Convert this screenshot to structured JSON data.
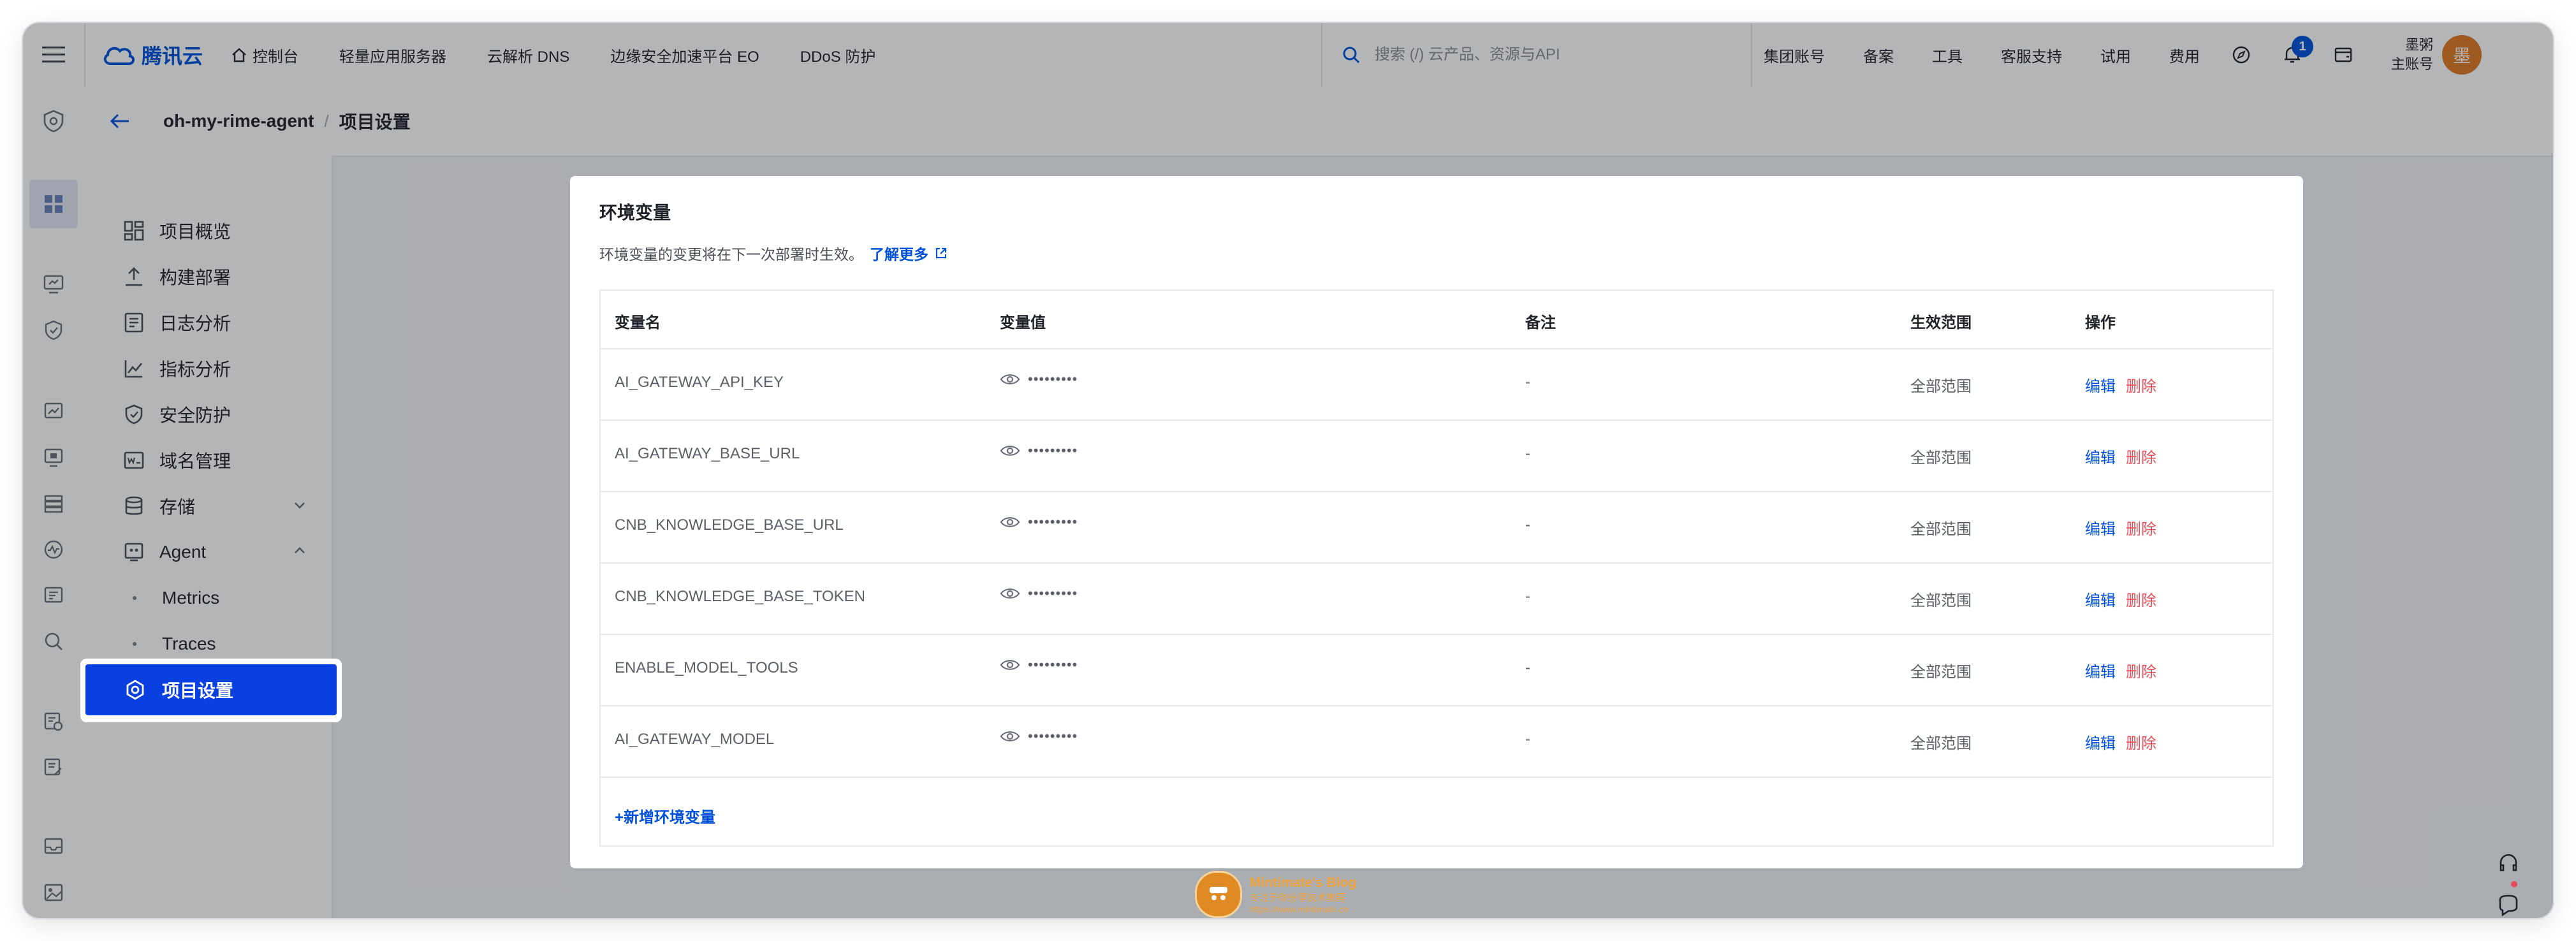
{
  "brand": {
    "name": "腾讯云"
  },
  "topnav": {
    "items": [
      "控制台",
      "轻量应用服务器",
      "云解析 DNS",
      "边缘安全加速平台 EO",
      "DDoS 防护"
    ],
    "search_placeholder": "搜索 (/) 云产品、资源与API",
    "right_items": [
      "集团账号",
      "备案",
      "工具",
      "客服支持",
      "试用",
      "费用"
    ],
    "notification_count": "1",
    "account_name": "墨粥",
    "account_role": "主账号",
    "avatar_char": "墨"
  },
  "breadcrumb": {
    "project": "oh-my-rime-agent",
    "separator": "/",
    "current": "项目设置"
  },
  "sidemenu": {
    "items": [
      {
        "label": "项目概览",
        "icon": "overview-icon"
      },
      {
        "label": "构建部署",
        "icon": "deploy-icon"
      },
      {
        "label": "日志分析",
        "icon": "log-icon"
      },
      {
        "label": "指标分析",
        "icon": "metrics-icon"
      },
      {
        "label": "安全防护",
        "icon": "shield-icon"
      },
      {
        "label": "域名管理",
        "icon": "domain-icon"
      },
      {
        "label": "存储",
        "icon": "storage-icon",
        "expanded": false
      },
      {
        "label": "Agent",
        "icon": "agent-icon",
        "expanded": true
      }
    ],
    "sub_items": [
      "Metrics",
      "Traces"
    ],
    "active": {
      "label": "项目设置",
      "icon": "settings-icon"
    }
  },
  "modal": {
    "title": "环境变量",
    "description": "环境变量的变更将在下一次部署时生效。",
    "learn_more": "了解更多",
    "columns": [
      "变量名",
      "变量值",
      "备注",
      "生效范围",
      "操作"
    ],
    "rows": [
      {
        "name": "AI_GATEWAY_API_KEY",
        "value": "•••••••••",
        "note": "-",
        "scope": "全部范围",
        "edit": "编辑",
        "delete": "删除"
      },
      {
        "name": "AI_GATEWAY_BASE_URL",
        "value": "•••••••••",
        "note": "-",
        "scope": "全部范围",
        "edit": "编辑",
        "delete": "删除"
      },
      {
        "name": "CNB_KNOWLEDGE_BASE_URL",
        "value": "•••••••••",
        "note": "-",
        "scope": "全部范围",
        "edit": "编辑",
        "delete": "删除"
      },
      {
        "name": "CNB_KNOWLEDGE_BASE_TOKEN",
        "value": "•••••••••",
        "note": "-",
        "scope": "全部范围",
        "edit": "编辑",
        "delete": "删除"
      },
      {
        "name": "ENABLE_MODEL_TOOLS",
        "value": "•••••••••",
        "note": "-",
        "scope": "全部范围",
        "edit": "编辑",
        "delete": "删除"
      },
      {
        "name": "AI_GATEWAY_MODEL",
        "value": "•••••••••",
        "note": "-",
        "scope": "全部范围",
        "edit": "编辑",
        "delete": "删除"
      }
    ],
    "add_button": "+新增环境变量"
  },
  "watermark": {
    "title": "Mintimate's Blog",
    "subtitle": "专注于你分享技术教程",
    "url": "https://www.mintimate.cn"
  },
  "colors": {
    "accent": "#0052d9",
    "danger": "#e34d59",
    "active_menu": "#0a3fe0",
    "avatar": "#e07a22"
  }
}
